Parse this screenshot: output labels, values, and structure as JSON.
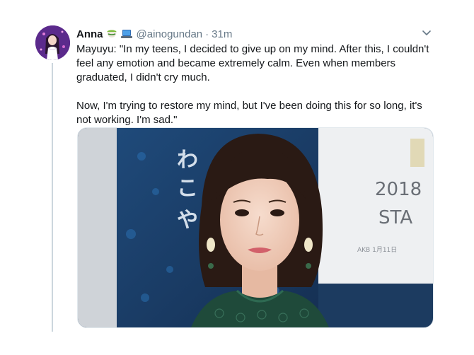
{
  "tweet": {
    "display_name": "Anna",
    "badges": [
      "matcha-cup-icon",
      "laptop-icon"
    ],
    "handle": "@ainogundan",
    "separator": "·",
    "time": "31m",
    "paragraphs": [
      "Mayuyu: \"In my teens, I decided to give up on my mind. After this, I couldn't feel any emotion and became extremely calm. Even when members graduated, I didn't cry much.",
      "Now, I'm trying to restore my mind, but I've been doing this for so long, it's not working. I'm sad.\""
    ],
    "media_text": {
      "backdrop_year": "2018",
      "backdrop_word": "STA",
      "backdrop_small": "AKB 1月11日"
    }
  },
  "colors": {
    "text": "#14171a",
    "secondary": "#657786",
    "thread_line": "#ccd6dd",
    "avatar_bg": "#6c2f9e"
  }
}
